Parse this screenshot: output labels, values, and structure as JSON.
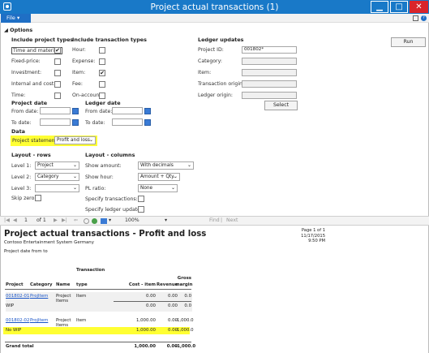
{
  "window": {
    "title": "Project actual transactions (1)",
    "app_icon": "sun-icon",
    "minimize": "▁",
    "maximize": "□",
    "close": "✕"
  },
  "menu": {
    "file_label": "File ▾"
  },
  "options": {
    "group_label": "◢ Options",
    "project_types_header": "Include project types",
    "project_types": [
      {
        "label": "Time and material:",
        "checked": true
      },
      {
        "label": "Fixed-price:",
        "checked": false
      },
      {
        "label": "Investment:",
        "checked": false
      },
      {
        "label": "Internal and cost:",
        "checked": false
      },
      {
        "label": "Time:",
        "checked": false
      }
    ],
    "transaction_types_header": "Include transaction types",
    "transaction_types": [
      {
        "label": "Hour:",
        "checked": false
      },
      {
        "label": "Expense:",
        "checked": false
      },
      {
        "label": "Item:",
        "checked": true
      },
      {
        "label": "Fee:",
        "checked": false
      },
      {
        "label": "On-account:",
        "checked": false
      }
    ],
    "ledger_updates_header": "Ledger updates",
    "ledger_fields": [
      {
        "label": "Project ID:",
        "value": "001802*"
      },
      {
        "label": "Category:",
        "value": ""
      },
      {
        "label": "Item:",
        "value": ""
      },
      {
        "label": "Transaction origin:",
        "value": ""
      },
      {
        "label": "Ledger origin:",
        "value": ""
      }
    ],
    "select_button": "Select",
    "run_button": "Run",
    "project_date_header": "Project date",
    "project_from_label": "From date:",
    "project_to_label": "To date:",
    "ledger_date_header": "Ledger date",
    "ledger_from_label": "From date:",
    "ledger_to_label": "To date:",
    "data_header": "Data",
    "project_statement_label": "Project statement:",
    "project_statement_value": "Profit and loss",
    "layout_rows_header": "Layout - rows",
    "levels": [
      {
        "label": "Level 1:",
        "value": "Project"
      },
      {
        "label": "Level 2:",
        "value": "Category"
      },
      {
        "label": "Level 3:",
        "value": ""
      }
    ],
    "skip_zero_label": "Skip zero:",
    "layout_columns_header": "Layout - columns",
    "show_amount_label": "Show amount:",
    "show_amount_value": "With decimals",
    "show_hour_label": "Show hour:",
    "show_hour_value": "Amount + Qty.",
    "pl_ratio_label": "PL ratio:",
    "pl_ratio_value": "None",
    "specify_transactions_label": "Specify transactions:",
    "specify_ledger_label": "Specify ledger updates:"
  },
  "viewer_toolbar": {
    "page_current": "1",
    "page_of": "of 1",
    "zoom": "100%",
    "find": "Find",
    "next": "Next"
  },
  "report": {
    "page_info": "Page 1 of 1",
    "date": "11/17/2015",
    "time": "9:50 PM",
    "title": "Project actual transactions - Profit and loss",
    "company": "Contoso Entertainment System Germany",
    "date_range": "Project date from  to",
    "columns": [
      "Project",
      "Category",
      "Name",
      "Transaction type",
      "Cost - item",
      "Revenue",
      "Gross margin"
    ],
    "col_trans_1": "Transaction",
    "col_trans_2": "type",
    "col_gross_1": "Gross",
    "col_gross_2": "margin",
    "rows": [
      {
        "project": "001802-01",
        "category": "ProjItem",
        "name": "Project Items",
        "type": "Item",
        "cost": "0.00",
        "revenue": "0.00",
        "margin": "0.0"
      },
      {
        "project": "001802-02",
        "category": "ProjItem",
        "name": "Project Items",
        "type": "Item",
        "cost": "1,000.00",
        "revenue": "0.00",
        "margin": "-1,000.0"
      }
    ],
    "subtotal_1": {
      "label": "WIP",
      "cost": "0.00",
      "revenue": "0.00",
      "margin": "0.0"
    },
    "subtotal_2": {
      "label": "No WIP",
      "cost": "1,000.00",
      "revenue": "0.00",
      "margin": "-1,000.0"
    },
    "grand_total": {
      "label": "Grand total",
      "cost": "1,000.00",
      "revenue": "0.00",
      "margin": "-1,000.0"
    },
    "highlight_color": "#ffff33"
  }
}
